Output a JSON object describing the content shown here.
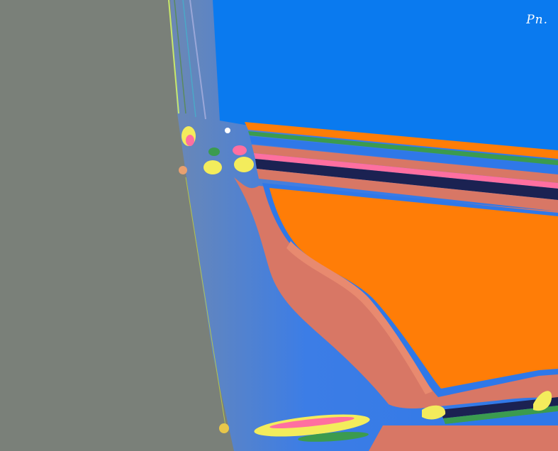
{
  "image": {
    "signature_text": "Pn.",
    "palette": {
      "gray_background": "#7a8079",
      "sky_blue": "#0a7aef",
      "mid_blue": "#2f78e8",
      "orange": "#ff7d07",
      "salmon": "#d87765",
      "navy": "#1b2252",
      "pink": "#ff6fa0",
      "yellow": "#f3ec5c",
      "green": "#3b9b4f",
      "white": "#ffffff"
    }
  }
}
